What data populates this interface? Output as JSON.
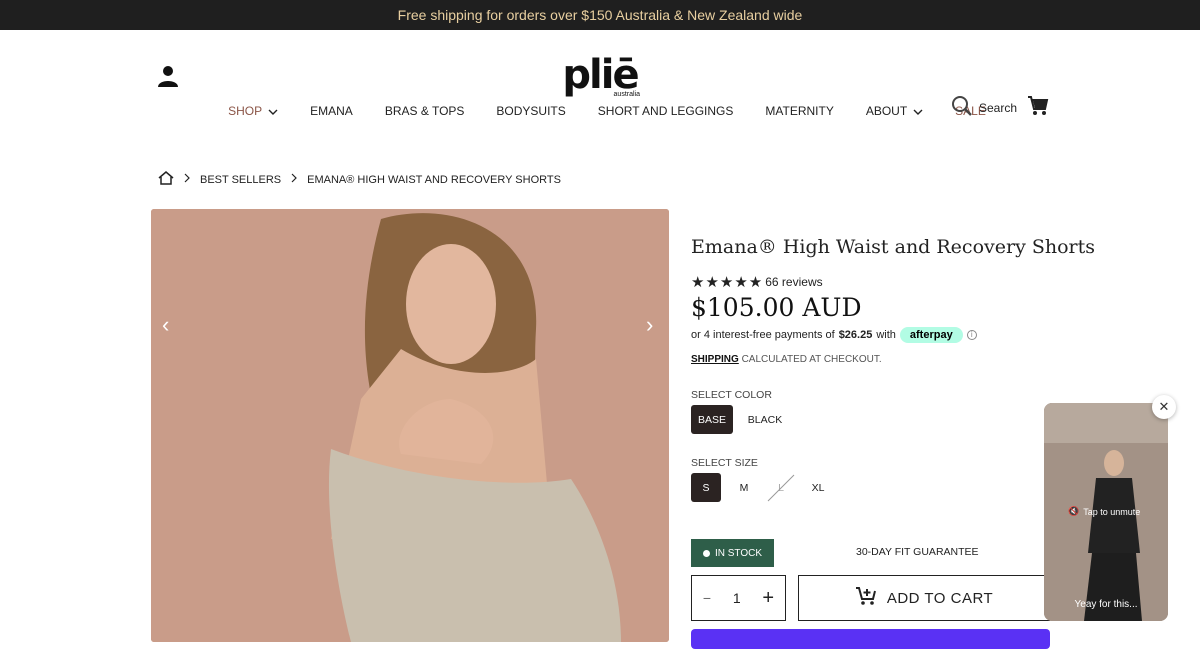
{
  "announcement": "Free shipping for orders over $150 Australia & New Zealand wide",
  "logo": {
    "main": "pliē",
    "sub": "australia"
  },
  "header": {
    "search_label": "Search"
  },
  "nav": {
    "items": [
      {
        "label": "SHOP",
        "dropdown": true,
        "accent": true
      },
      {
        "label": "EMANA"
      },
      {
        "label": "BRAS & TOPS"
      },
      {
        "label": "BODYSUITS"
      },
      {
        "label": "SHORT AND LEGGINGS"
      },
      {
        "label": "MATERNITY"
      },
      {
        "label": "ABOUT",
        "dropdown": true
      },
      {
        "label": "SALE",
        "accent": true
      }
    ]
  },
  "breadcrumb": {
    "items": [
      "BEST SELLERS",
      "EMANA® HIGH WAIST AND RECOVERY SHORTS"
    ]
  },
  "product": {
    "title": "Emana® High Waist and Recovery Shorts",
    "stars": "★★★★★",
    "reviews": "66 reviews",
    "price": "$105.00 AUD",
    "afterpay_prefix": "or 4 interest-free payments of",
    "afterpay_amount": "$26.25",
    "afterpay_with": "with",
    "afterpay_brand": "afterpay",
    "shipping_link": "SHIPPING",
    "shipping_rest": "CALCULATED AT CHECKOUT.",
    "color_label": "SELECT COLOR",
    "colors": [
      "BASE",
      "BLACK"
    ],
    "size_label": "SELECT SIZE",
    "sizes": [
      "S",
      "M",
      "L",
      "XL"
    ],
    "stock": "IN STOCK",
    "guarantee": "30-DAY FIT GUARANTEE",
    "qty": "1",
    "qty_minus": "−",
    "qty_plus": "+",
    "add_to_cart": "ADD TO CART"
  },
  "video": {
    "tap": "Tap to unmute",
    "caption": "Yeay for this..."
  },
  "colors": {
    "announce_bg": "#1f1f1f",
    "accent": "#8a5446",
    "stock": "#2e5e49",
    "shop_pay": "#5a31f4"
  }
}
